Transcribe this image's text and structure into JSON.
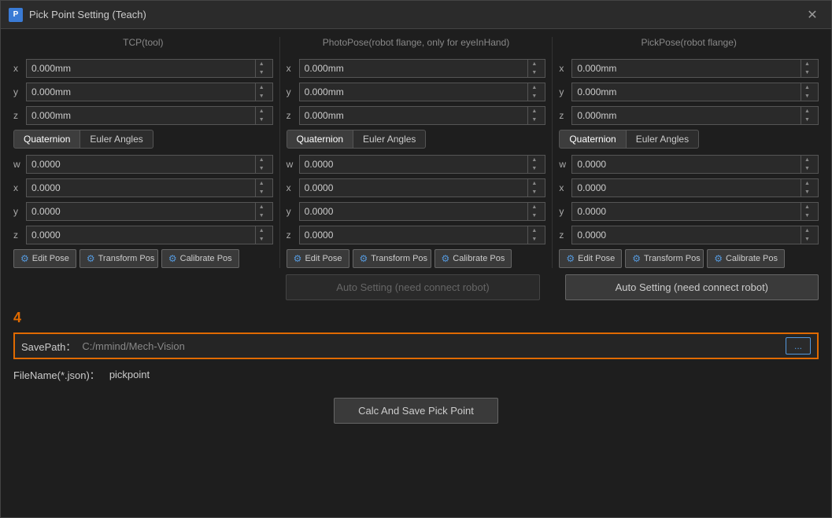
{
  "window": {
    "title": "Pick Point Setting  (Teach)",
    "icon_label": "P",
    "close_label": "✕"
  },
  "columns": {
    "tcp": {
      "header": "TCP(tool)",
      "x": "0.000mm",
      "y": "0.000mm",
      "z": "0.000mm",
      "tab_quaternion": "Quaternion",
      "tab_euler": "Euler Angles",
      "w": "0.0000",
      "qx": "0.0000",
      "qy": "0.0000",
      "qz": "0.0000",
      "btn_edit": "Edit Pose",
      "btn_transform": "Transform Pos",
      "btn_calibrate": "Calibrate Pos"
    },
    "photo": {
      "header": "PhotoPose(robot flange, only for eyeInHand)",
      "x": "0.000mm",
      "y": "0.000mm",
      "z": "0.000mm",
      "tab_quaternion": "Quaternion",
      "tab_euler": "Euler Angles",
      "w": "0.0000",
      "qx": "0.0000",
      "qy": "0.0000",
      "qz": "0.0000",
      "btn_edit": "Edit Pose",
      "btn_transform": "Transform Pos",
      "btn_calibrate": "Calibrate Pos",
      "auto_btn": "Auto Setting  (need connect robot)",
      "auto_btn_disabled": true
    },
    "pick": {
      "header": "PickPose(robot flange)",
      "x": "0.000mm",
      "y": "0.000mm",
      "z": "0.000mm",
      "tab_quaternion": "Quaternion",
      "tab_euler": "Euler Angles",
      "w": "0.0000",
      "qx": "0.0000",
      "qy": "0.0000",
      "qz": "0.0000",
      "btn_edit": "Edit Pose",
      "btn_transform": "Transform Pos",
      "btn_calibrate": "Calibrate Pos",
      "auto_btn": "Auto Setting  (need connect robot)"
    }
  },
  "step": {
    "number": "4"
  },
  "save_path": {
    "label": "SavePath：",
    "value": "C:/mmind/Mech-Vision",
    "browse_btn": "..."
  },
  "filename": {
    "label": "FileName(*.json)：",
    "value": "pickpoint"
  },
  "calc_btn": "Calc And Save Pick Point"
}
